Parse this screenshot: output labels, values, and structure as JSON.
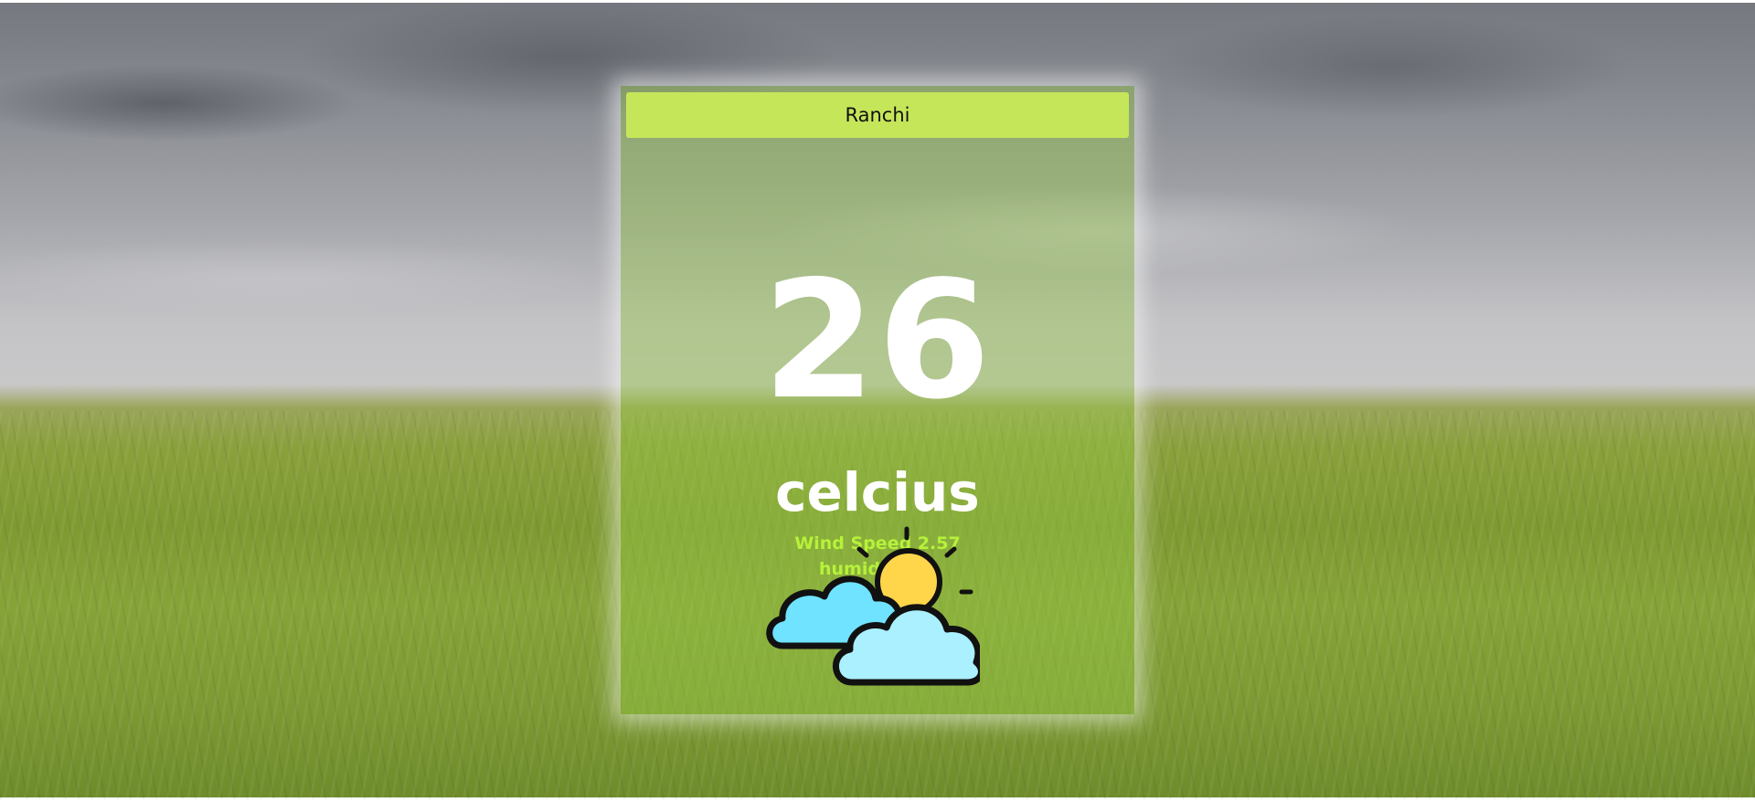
{
  "search": {
    "city_value": "Ranchi"
  },
  "weather": {
    "temperature": "26",
    "unit_label": "celcius",
    "wind_text": "Wind Speed 2.57",
    "humidity_text": "humidity 83",
    "condition_icon": "partly-cloudy-icon"
  },
  "colors": {
    "input_background": "#c6e65a",
    "card_tint": "#96c846",
    "detail_text": "#b6f23a",
    "temperature_text": "#ffffff"
  }
}
